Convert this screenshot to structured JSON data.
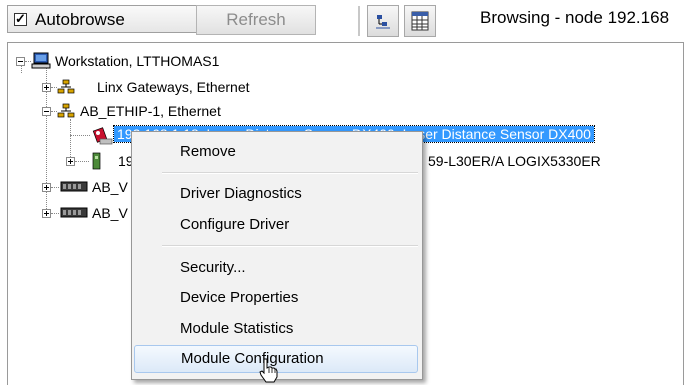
{
  "toolbar": {
    "autobrowse_label": "Autobrowse",
    "autobrowse_checked": true,
    "refresh_label": "Refresh",
    "icons": [
      "browse-mode-icon",
      "grid-view-icon"
    ],
    "status_text": "Browsing - node 192.168"
  },
  "tree": {
    "root": "Workstation, LTTHOMAS1",
    "linx": "Linx Gateways, Ethernet",
    "ethip": "AB_ETHIP-1, Ethernet",
    "device1": "192.168.1.18, Laser Distance Sensor DX400, Laser Distance Sensor DX400",
    "device2_prefix": "19",
    "device2_suffix": "59-L30ER/A LOGIX5330ER",
    "ab_v1": "AB_V",
    "ab_v2": "AB_V"
  },
  "context_menu": {
    "items": [
      "Remove",
      "Driver Diagnostics",
      "Configure Driver",
      "Security...",
      "Device Properties",
      "Module Statistics",
      "Module Configuration"
    ],
    "hovered_item": "Module Configuration"
  }
}
